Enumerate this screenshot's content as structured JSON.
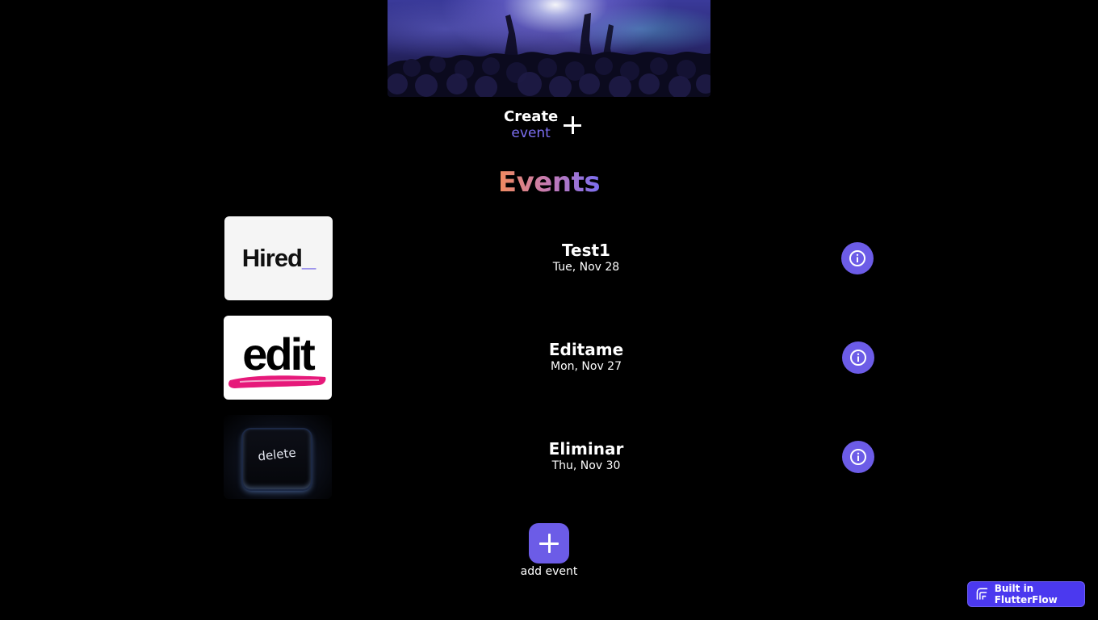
{
  "create": {
    "title": "Create",
    "subtitle": "event"
  },
  "events_title": "Events",
  "events": [
    {
      "name": "Test1",
      "date": "Tue, Nov 28",
      "thumb_text": "Hired",
      "thumb_accent": "_"
    },
    {
      "name": "Editame",
      "date": "Mon, Nov 27",
      "thumb_text": "edit"
    },
    {
      "name": "Eliminar",
      "date": "Thu, Nov 30",
      "thumb_text": "delete"
    }
  ],
  "add_event_label": "add event",
  "badge_label": "Built in FlutterFlow",
  "colors": {
    "accent": "#6c5ce7",
    "badge": "#4b39ef",
    "title_gradient_start": "#f08a5d",
    "title_gradient_end": "#7b6ef0",
    "background": "#000000"
  }
}
